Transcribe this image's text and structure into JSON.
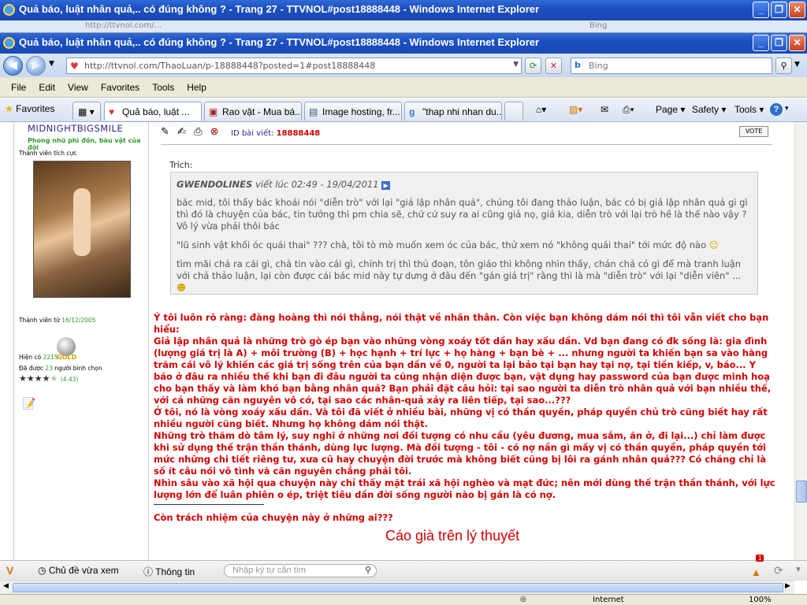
{
  "window": {
    "title": "Quả báo, luật nhân quả,.. có đúng không ? - Trang 27 - TTVNOL#post18888448 - Windows Internet Explorer",
    "ghost_title": "Quả báo, luật nhân quả,.. có đúng không ? - Trang 27 - TTVNOL#post18888448 - Windows Internet Explorer",
    "ghost_url": "http://ttvnol.com/...",
    "ghost_search": "Bing"
  },
  "address": {
    "url": "http://ttvnol.com/ThaoLuan/p-18888448?posted=1#post18888448",
    "search_placeholder": "Bing"
  },
  "menu": [
    "File",
    "Edit",
    "View",
    "Favorites",
    "Tools",
    "Help"
  ],
  "favorites_label": "Favorites",
  "tabs": [
    {
      "label": "Quả báo, luật ...",
      "active": true
    },
    {
      "label": "Rao vặt - Mua bá...",
      "active": false
    },
    {
      "label": "Image hosting, fr...",
      "active": false
    },
    {
      "label": "\"thap nhi nhan du...",
      "active": false
    }
  ],
  "toolbar": {
    "page": "Page",
    "safety": "Safety",
    "tools": "Tools",
    "help": "?"
  },
  "user": {
    "name": "MIDNIGHTBIGSMILE",
    "title": "Phong nhũ phì đồn, bàu vật của đời",
    "rank": "Thành viên tích cực",
    "member_since_label": "Thành viên từ",
    "member_since": "16/12/2005",
    "posts_label": "Hiện có",
    "posts": "2215",
    "badge": "GOLD",
    "rated_label": "Đã được",
    "rated_count": "23",
    "rated_suffix": "người bình chọn",
    "rating": "(4.43)",
    "stars": 4
  },
  "post": {
    "id_label": "ID bài viết:",
    "id": "18888448",
    "vote": "VOTE",
    "quote_label": "Trích:",
    "quote_author": "GWENDOLINES",
    "quote_meta": "viết lúc 02:49 - 19/04/2011",
    "quote_p1": "bác mid, tôi thấy bác khoái nói \"diễn trò\" với lại \"giả lập nhân quả\", chúng tôi đang thảo luận, bác có bị giả lập nhân quả gì gì thì đó là chuyện của bác, tin tưởng thì pm chia sẽ, chứ cứ suy ra ai cũng giả nọ, giả kia, diễn trò với lại trò hề là thế nào vậy ? Vô lý vừa phải thôi bác",
    "quote_p2": "\"lũ sinh vật khối óc quái thai\" ??? chà, tôi tò mò muốn xem óc của bác, thử xem nó \"không quái thai\" tới mức độ nào",
    "quote_p3": "tìm mãi chả ra cái gì, chả tin vào cái gì, chính trị thì thủ đoạn, tôn giáo thì không nhìn thấy, chán chả có gì để mà tranh luận với chả thảo luận, lại còn được cái bác mid này tự dưng ở đâu đến \"gán giá trị\" rằng thì là mà \"diễn trò\" với lại \"diễn viên\" ...",
    "body": [
      "Ý tôi luôn rõ ràng: đàng hoàng thì nói thẳng, nói thật về nhân thân. Còn việc bạn không dám nói thì tôi vẫn viết cho bạn hiểu:",
      "Giả lập nhân quả là những trò gò ép bạn vào những vòng xoáy tốt dần hay xấu dần. Vd bạn đang có đk sống là: gia đình (lượng giá trị là A) + môi trường (B) + học hạnh + trí lực + họ hàng + bạn bè + ... nhưng người ta khiến bạn sa vào hàng trăm cái vô lý khiến các giá trị sống trên của bạn dần về 0, người ta lại bảo tại bạn hay tại nợ, tại tiền kiếp, v, báo... Y báo ở đâu ra nhiều thế khi bạn đi đâu người ta cũng nhận diện được bạn, vật dụng hay password của bạn được minh hoạ cho bạn thấy và làm khó bạn bằng nhân quả? Bạn phải đặt câu hỏi: tại sao người ta diễn trò nhân quả với bạn nhiều thế, với cả những căn nguyên vô cớ, tại sao các nhân-quả xảy ra liên tiếp, tại sao...???",
      "Ở tôi, nó là vòng xoáy xấu dần. Và tôi đã viết ở nhiều bài, những vị có thần quyền, pháp quyền chủ trò cũng biết hay rất nhiều người cũng biết. Nhưng họ không dám nói thật.",
      "Những trò thăm dò tâm lý, suy nghĩ ở những nơi đối tượng có nhu cầu (yêu đương, mua sắm, ăn ở, đi lại...) chỉ làm được khi sử dụng thế trận thần thánh, dùng lực lượng. Mà đối tượng - tôi - có nợ nần gì mấy vị có thần quyền, pháp quyền tới mức những chi tiết riêng tư, xưa cũ hay chuyện đời trước mà không biết cũng bị lôi ra gánh nhân quả??? Có chăng chỉ là số ít câu nói vô tình và căn nguyên chẳng phải tôi.",
      "Nhìn sâu vào xã hội qua chuyện này chỉ thấy mặt trái xã hội nghèo và mạt đức; nên mới dùng thế trận thần thánh, với lực lượng lớn để luân phiên o ép, triệt tiêu dần đời sống người nào bị gán là có nợ."
    ],
    "closing": "Còn trách nhiệm của chuyện này ở những ai???",
    "signature": "Cáo già trên lý thuyết"
  },
  "statusbar": {
    "recent": "Chủ đề vừa xem",
    "info": "Thông tin",
    "search_placeholder": "Nhập ký tự cần tìm",
    "notif": "1",
    "zone": "Internet",
    "zoom": "100%"
  },
  "colors": {
    "post_text": "#d40000",
    "link_green": "#2f9a2f",
    "signature": "#d40000"
  }
}
